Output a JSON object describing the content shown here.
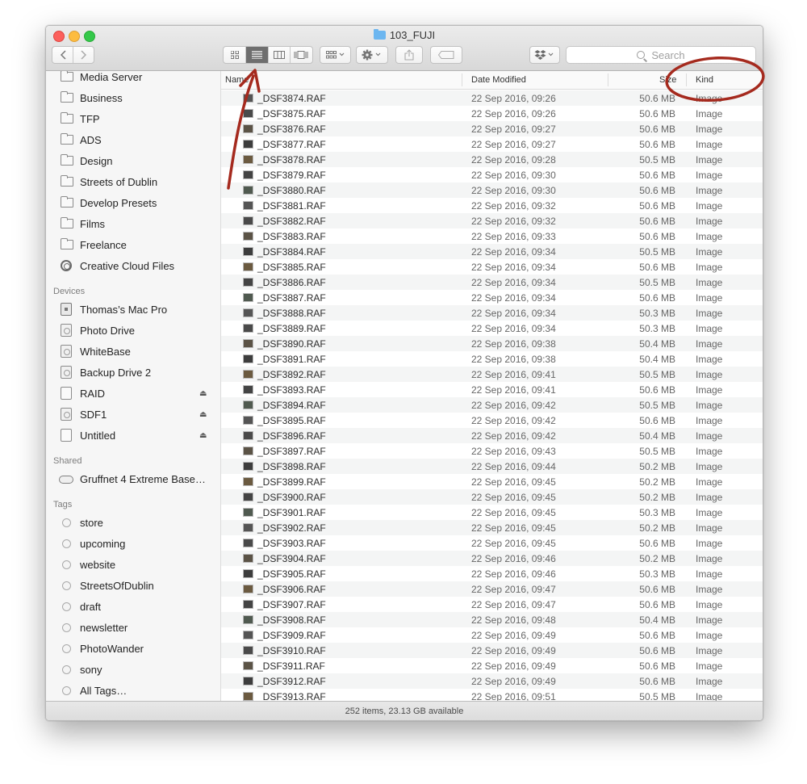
{
  "window": {
    "title": "103_FUJI"
  },
  "toolbar": {
    "back_icon": "chevron-left-icon",
    "forward_icon": "chevron-right-icon",
    "view_modes": [
      "icon-view-icon",
      "list-view-icon",
      "column-view-icon",
      "coverflow-view-icon"
    ],
    "active_view": "list",
    "search_placeholder": "Search"
  },
  "sidebar": {
    "favorites": [
      {
        "label": "Media Server",
        "icon": "server-icon"
      },
      {
        "label": "Business",
        "icon": "folder-icon"
      },
      {
        "label": "TFP",
        "icon": "folder-icon"
      },
      {
        "label": "ADS",
        "icon": "folder-icon"
      },
      {
        "label": "Design",
        "icon": "folder-icon"
      },
      {
        "label": "Streets of Dublin",
        "icon": "folder-icon"
      },
      {
        "label": "Develop Presets",
        "icon": "folder-icon"
      },
      {
        "label": "Films",
        "icon": "folder-icon"
      },
      {
        "label": "Freelance",
        "icon": "folder-icon"
      },
      {
        "label": "Creative Cloud Files",
        "icon": "creative-cloud-icon"
      }
    ],
    "devices_header": "Devices",
    "devices": [
      {
        "label": "Thomas’s Mac Pro",
        "icon": "mac-icon",
        "eject": false
      },
      {
        "label": "Photo Drive",
        "icon": "drive-icon",
        "eject": false
      },
      {
        "label": "WhiteBase",
        "icon": "drive-icon",
        "eject": false
      },
      {
        "label": "Backup Drive 2",
        "icon": "drive-icon",
        "eject": false
      },
      {
        "label": "RAID",
        "icon": "disk-icon",
        "eject": true
      },
      {
        "label": "SDF1",
        "icon": "drive-icon",
        "eject": true
      },
      {
        "label": "Untitled",
        "icon": "disk-icon",
        "eject": true
      }
    ],
    "eject_glyph": "⏏",
    "shared_header": "Shared",
    "shared": [
      {
        "label": "Gruffnet 4 Extreme Base…",
        "icon": "network-base-icon"
      }
    ],
    "tags_header": "Tags",
    "tags": [
      "store",
      "upcoming",
      "website",
      "StreetsOfDublin",
      "draft",
      "newsletter",
      "PhotoWander",
      "sony",
      "All Tags…"
    ]
  },
  "list": {
    "columns": {
      "name": "Name",
      "date": "Date Modified",
      "size": "Size",
      "kind": "Kind"
    },
    "rows": [
      {
        "name": "_DSF3874.RAF",
        "date": "22 Sep 2016, 09:26",
        "size": "50.6 MB",
        "kind": "Image"
      },
      {
        "name": "_DSF3875.RAF",
        "date": "22 Sep 2016, 09:26",
        "size": "50.6 MB",
        "kind": "Image"
      },
      {
        "name": "_DSF3876.RAF",
        "date": "22 Sep 2016, 09:27",
        "size": "50.6 MB",
        "kind": "Image"
      },
      {
        "name": "_DSF3877.RAF",
        "date": "22 Sep 2016, 09:27",
        "size": "50.6 MB",
        "kind": "Image"
      },
      {
        "name": "_DSF3878.RAF",
        "date": "22 Sep 2016, 09:28",
        "size": "50.5 MB",
        "kind": "Image"
      },
      {
        "name": "_DSF3879.RAF",
        "date": "22 Sep 2016, 09:30",
        "size": "50.6 MB",
        "kind": "Image"
      },
      {
        "name": "_DSF3880.RAF",
        "date": "22 Sep 2016, 09:30",
        "size": "50.6 MB",
        "kind": "Image"
      },
      {
        "name": "_DSF3881.RAF",
        "date": "22 Sep 2016, 09:32",
        "size": "50.6 MB",
        "kind": "Image"
      },
      {
        "name": "_DSF3882.RAF",
        "date": "22 Sep 2016, 09:32",
        "size": "50.6 MB",
        "kind": "Image"
      },
      {
        "name": "_DSF3883.RAF",
        "date": "22 Sep 2016, 09:33",
        "size": "50.6 MB",
        "kind": "Image"
      },
      {
        "name": "_DSF3884.RAF",
        "date": "22 Sep 2016, 09:34",
        "size": "50.5 MB",
        "kind": "Image"
      },
      {
        "name": "_DSF3885.RAF",
        "date": "22 Sep 2016, 09:34",
        "size": "50.6 MB",
        "kind": "Image"
      },
      {
        "name": "_DSF3886.RAF",
        "date": "22 Sep 2016, 09:34",
        "size": "50.5 MB",
        "kind": "Image"
      },
      {
        "name": "_DSF3887.RAF",
        "date": "22 Sep 2016, 09:34",
        "size": "50.6 MB",
        "kind": "Image"
      },
      {
        "name": "_DSF3888.RAF",
        "date": "22 Sep 2016, 09:34",
        "size": "50.3 MB",
        "kind": "Image"
      },
      {
        "name": "_DSF3889.RAF",
        "date": "22 Sep 2016, 09:34",
        "size": "50.3 MB",
        "kind": "Image"
      },
      {
        "name": "_DSF3890.RAF",
        "date": "22 Sep 2016, 09:38",
        "size": "50.4 MB",
        "kind": "Image"
      },
      {
        "name": "_DSF3891.RAF",
        "date": "22 Sep 2016, 09:38",
        "size": "50.4 MB",
        "kind": "Image"
      },
      {
        "name": "_DSF3892.RAF",
        "date": "22 Sep 2016, 09:41",
        "size": "50.5 MB",
        "kind": "Image"
      },
      {
        "name": "_DSF3893.RAF",
        "date": "22 Sep 2016, 09:41",
        "size": "50.6 MB",
        "kind": "Image"
      },
      {
        "name": "_DSF3894.RAF",
        "date": "22 Sep 2016, 09:42",
        "size": "50.5 MB",
        "kind": "Image"
      },
      {
        "name": "_DSF3895.RAF",
        "date": "22 Sep 2016, 09:42",
        "size": "50.6 MB",
        "kind": "Image"
      },
      {
        "name": "_DSF3896.RAF",
        "date": "22 Sep 2016, 09:42",
        "size": "50.4 MB",
        "kind": "Image"
      },
      {
        "name": "_DSF3897.RAF",
        "date": "22 Sep 2016, 09:43",
        "size": "50.5 MB",
        "kind": "Image"
      },
      {
        "name": "_DSF3898.RAF",
        "date": "22 Sep 2016, 09:44",
        "size": "50.2 MB",
        "kind": "Image"
      },
      {
        "name": "_DSF3899.RAF",
        "date": "22 Sep 2016, 09:45",
        "size": "50.2 MB",
        "kind": "Image"
      },
      {
        "name": "_DSF3900.RAF",
        "date": "22 Sep 2016, 09:45",
        "size": "50.2 MB",
        "kind": "Image"
      },
      {
        "name": "_DSF3901.RAF",
        "date": "22 Sep 2016, 09:45",
        "size": "50.3 MB",
        "kind": "Image"
      },
      {
        "name": "_DSF3902.RAF",
        "date": "22 Sep 2016, 09:45",
        "size": "50.2 MB",
        "kind": "Image"
      },
      {
        "name": "_DSF3903.RAF",
        "date": "22 Sep 2016, 09:45",
        "size": "50.6 MB",
        "kind": "Image"
      },
      {
        "name": "_DSF3904.RAF",
        "date": "22 Sep 2016, 09:46",
        "size": "50.2 MB",
        "kind": "Image"
      },
      {
        "name": "_DSF3905.RAF",
        "date": "22 Sep 2016, 09:46",
        "size": "50.3 MB",
        "kind": "Image"
      },
      {
        "name": "_DSF3906.RAF",
        "date": "22 Sep 2016, 09:47",
        "size": "50.6 MB",
        "kind": "Image"
      },
      {
        "name": "_DSF3907.RAF",
        "date": "22 Sep 2016, 09:47",
        "size": "50.6 MB",
        "kind": "Image"
      },
      {
        "name": "_DSF3908.RAF",
        "date": "22 Sep 2016, 09:48",
        "size": "50.4 MB",
        "kind": "Image"
      },
      {
        "name": "_DSF3909.RAF",
        "date": "22 Sep 2016, 09:49",
        "size": "50.6 MB",
        "kind": "Image"
      },
      {
        "name": "_DSF3910.RAF",
        "date": "22 Sep 2016, 09:49",
        "size": "50.6 MB",
        "kind": "Image"
      },
      {
        "name": "_DSF3911.RAF",
        "date": "22 Sep 2016, 09:49",
        "size": "50.6 MB",
        "kind": "Image"
      },
      {
        "name": "_DSF3912.RAF",
        "date": "22 Sep 2016, 09:49",
        "size": "50.6 MB",
        "kind": "Image"
      },
      {
        "name": "_DSF3913.RAF",
        "date": "22 Sep 2016, 09:51",
        "size": "50.5 MB",
        "kind": "Image"
      }
    ]
  },
  "status": {
    "text": "252 items, 23.13 GB available"
  },
  "annotation": {
    "color": "#a52a1e"
  }
}
